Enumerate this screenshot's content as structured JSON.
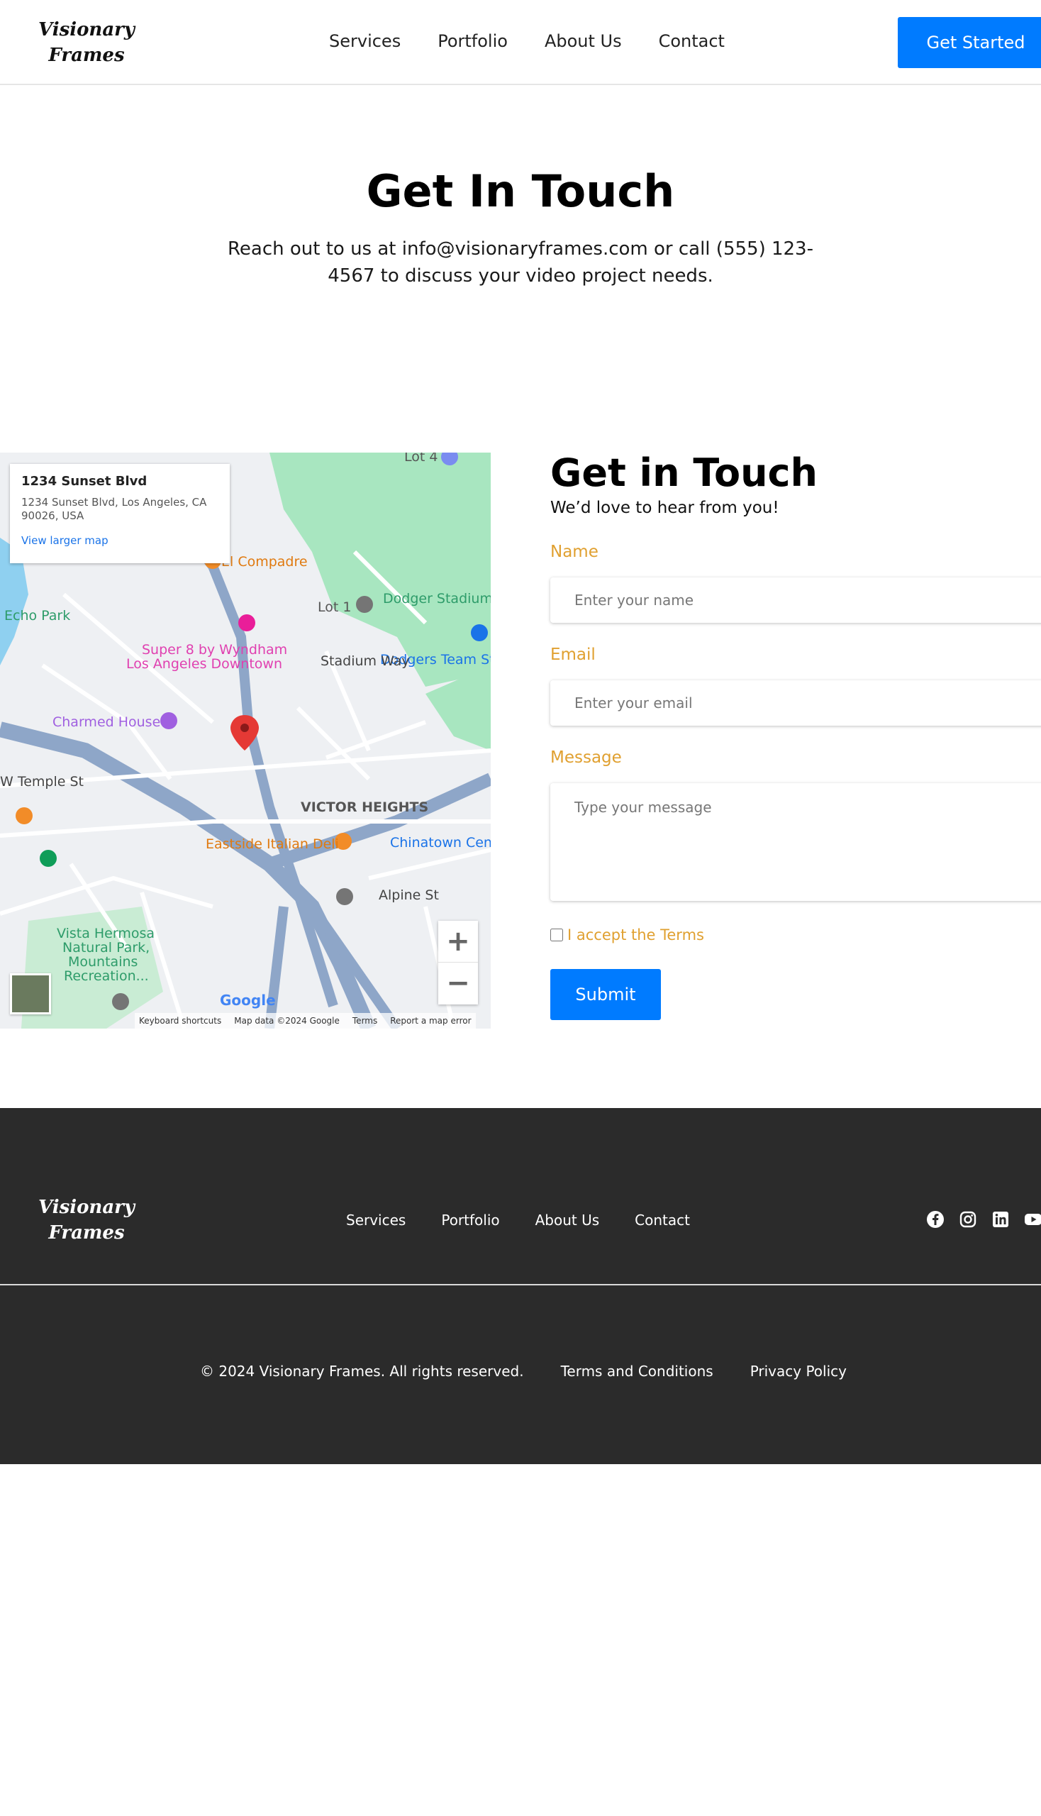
{
  "header": {
    "logo_line1": "Visionary",
    "logo_line2": "Frames",
    "nav": [
      "Services",
      "Portfolio",
      "About Us",
      "Contact"
    ],
    "cta_label": "Get Started"
  },
  "hero": {
    "title": "Get In Touch",
    "subtitle": "Reach out to us at info@visionaryframes.com or call (555) 123-4567 to discuss your video project needs."
  },
  "map": {
    "card_title": "1234 Sunset Blvd",
    "card_address": "1234 Sunset Blvd, Los Angeles, CA 90026, USA",
    "card_link": "View larger map",
    "zoom_in": "+",
    "zoom_out": "−",
    "google": "Google",
    "attribution": [
      "Keyboard shortcuts",
      "Map data ©2024 Google",
      "Terms",
      "Report a map error"
    ],
    "labels": {
      "echo_park": "Echo Park",
      "compadre": "El Compadre",
      "dodger_stadium": "Dodger Stadium",
      "lot1": "Lot 1",
      "lot4": "Lot 4",
      "super8": "Super 8 by Wyndham",
      "super8b": "Los Angeles Downtown",
      "dodgers_team": "Dodgers Team St",
      "charmed": "Charmed House",
      "victor": "VICTOR HEIGHTS",
      "eastside": "Eastside Italian Deli",
      "chinatown": "Chinatown Cent",
      "vista": "Vista Hermosa",
      "vista2": "Natural Park,",
      "vista3": "Mountains",
      "vista4": "Recreation...",
      "alpine": "Alpine St",
      "temple": "W Temple St",
      "stadium_way": "Stadium Way"
    }
  },
  "form": {
    "title": "Get in Touch",
    "subtitle": "We’d love to hear from you!",
    "name_label": "Name",
    "name_placeholder": "Enter your name",
    "email_label": "Email",
    "email_placeholder": "Enter your email",
    "message_label": "Message",
    "message_placeholder": "Type your message",
    "terms_label": "I accept the Terms",
    "submit_label": "Submit"
  },
  "footer": {
    "logo_line1": "Visionary",
    "logo_line2": "Frames",
    "nav": [
      "Services",
      "Portfolio",
      "About Us",
      "Contact"
    ],
    "social": [
      "facebook-icon",
      "instagram-icon",
      "linkedin-icon",
      "youtube-icon"
    ],
    "copyright": "© 2024 Visionary Frames. All rights reserved.",
    "terms": "Terms and Conditions",
    "privacy": "Privacy Policy"
  },
  "colors": {
    "primary": "#007bff",
    "accent": "#e0a030",
    "footer_bg": "#2b2b2b"
  }
}
